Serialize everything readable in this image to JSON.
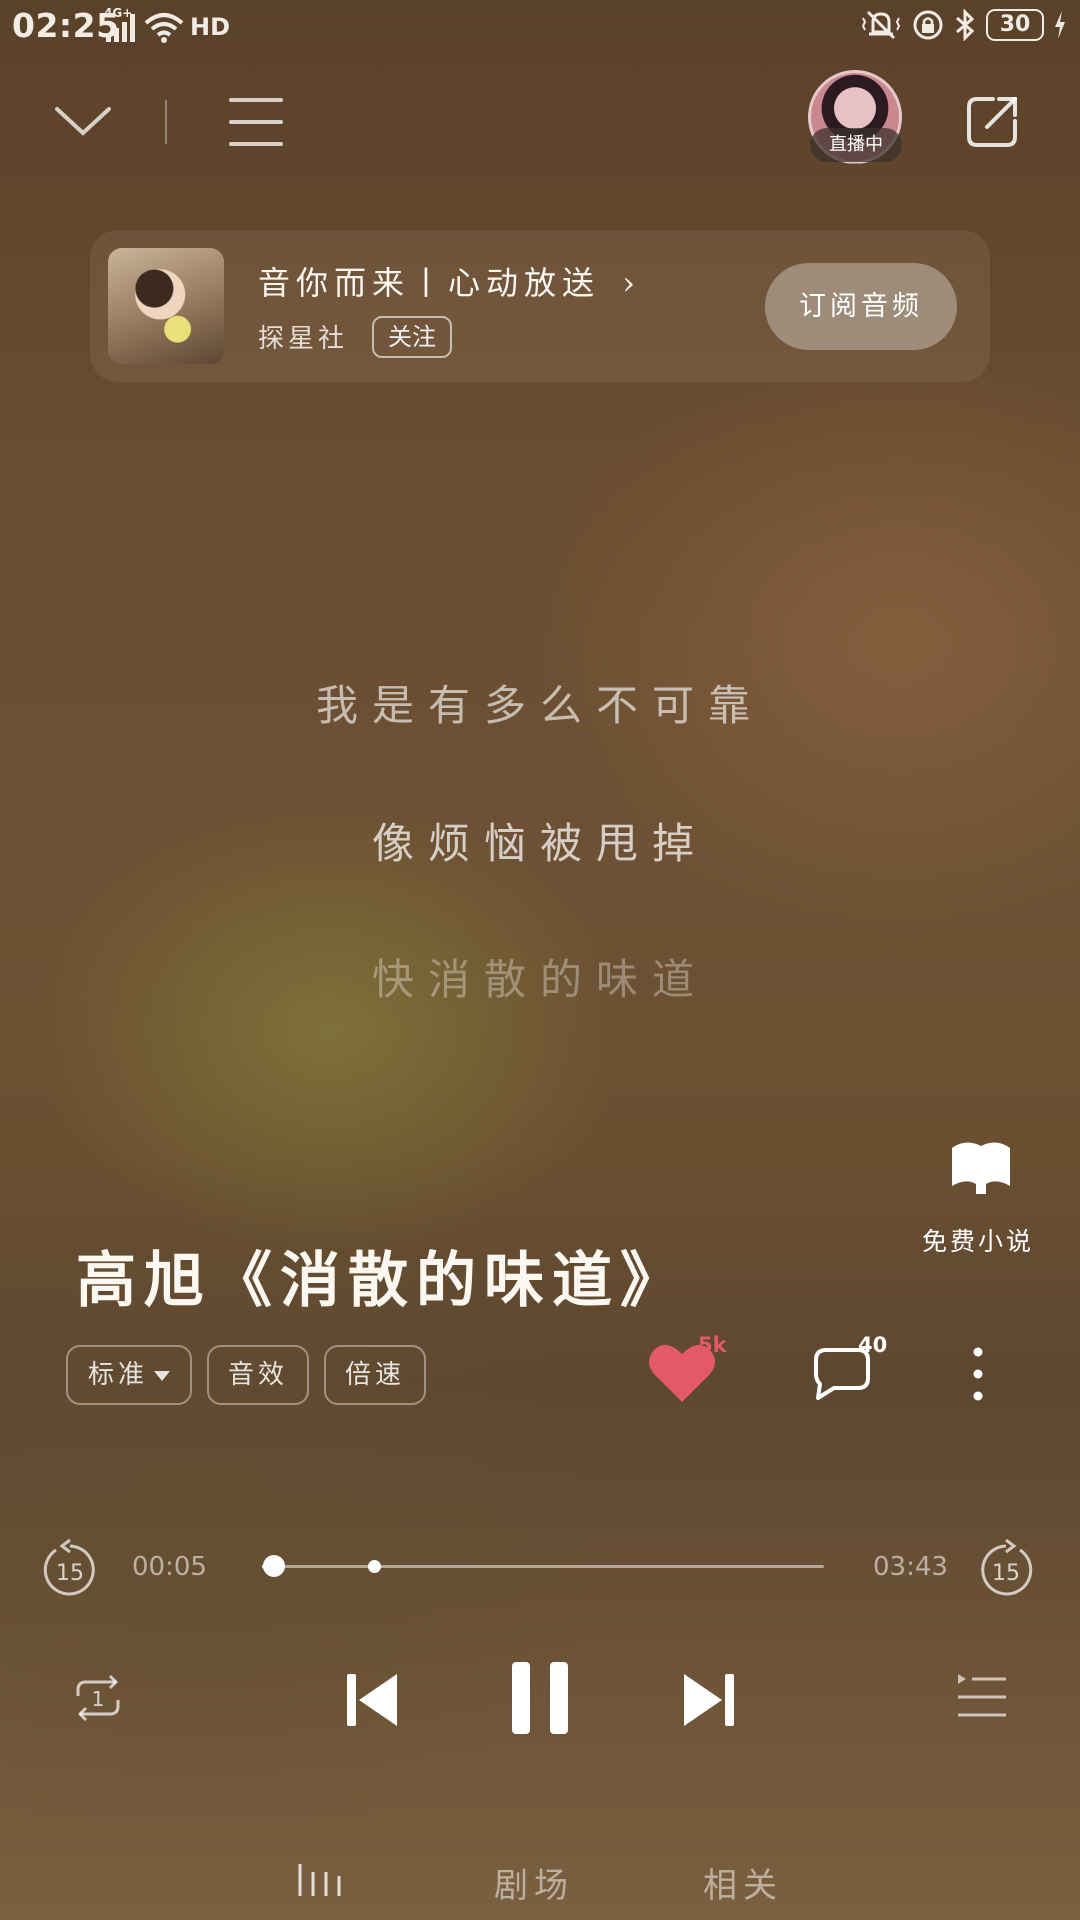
{
  "status_bar": {
    "time": "02:25",
    "network": "4G+",
    "hd": "HD",
    "battery": "30"
  },
  "top_nav": {
    "live_badge": "直播中"
  },
  "podcast_card": {
    "title": "音你而来丨心动放送",
    "channel": "探星社",
    "follow_label": "关注",
    "subscribe_label": "订阅音频"
  },
  "lyrics": [
    "我是有多么不可靠",
    "像烦恼被甩掉",
    "快消散的味道"
  ],
  "free_novel": {
    "label": "免费小说",
    "icon": "book-icon"
  },
  "song": {
    "title": "高旭《消散的味道》"
  },
  "chips": [
    {
      "label": "标准"
    },
    {
      "label": "音效"
    },
    {
      "label": "倍速"
    }
  ],
  "actions": {
    "like_count": "5k",
    "comment_count": "40",
    "like_color": "#e35a66"
  },
  "progress": {
    "current": "00:05",
    "total": "03:43",
    "fraction": 0.022,
    "buffered_fraction": 0.2,
    "skip_back_seconds": "15",
    "skip_forward_seconds": "15"
  },
  "controls": {
    "repeat_mode": "1"
  },
  "bottom_tabs": [
    {
      "label": "剧场"
    },
    {
      "label": "相关"
    }
  ]
}
